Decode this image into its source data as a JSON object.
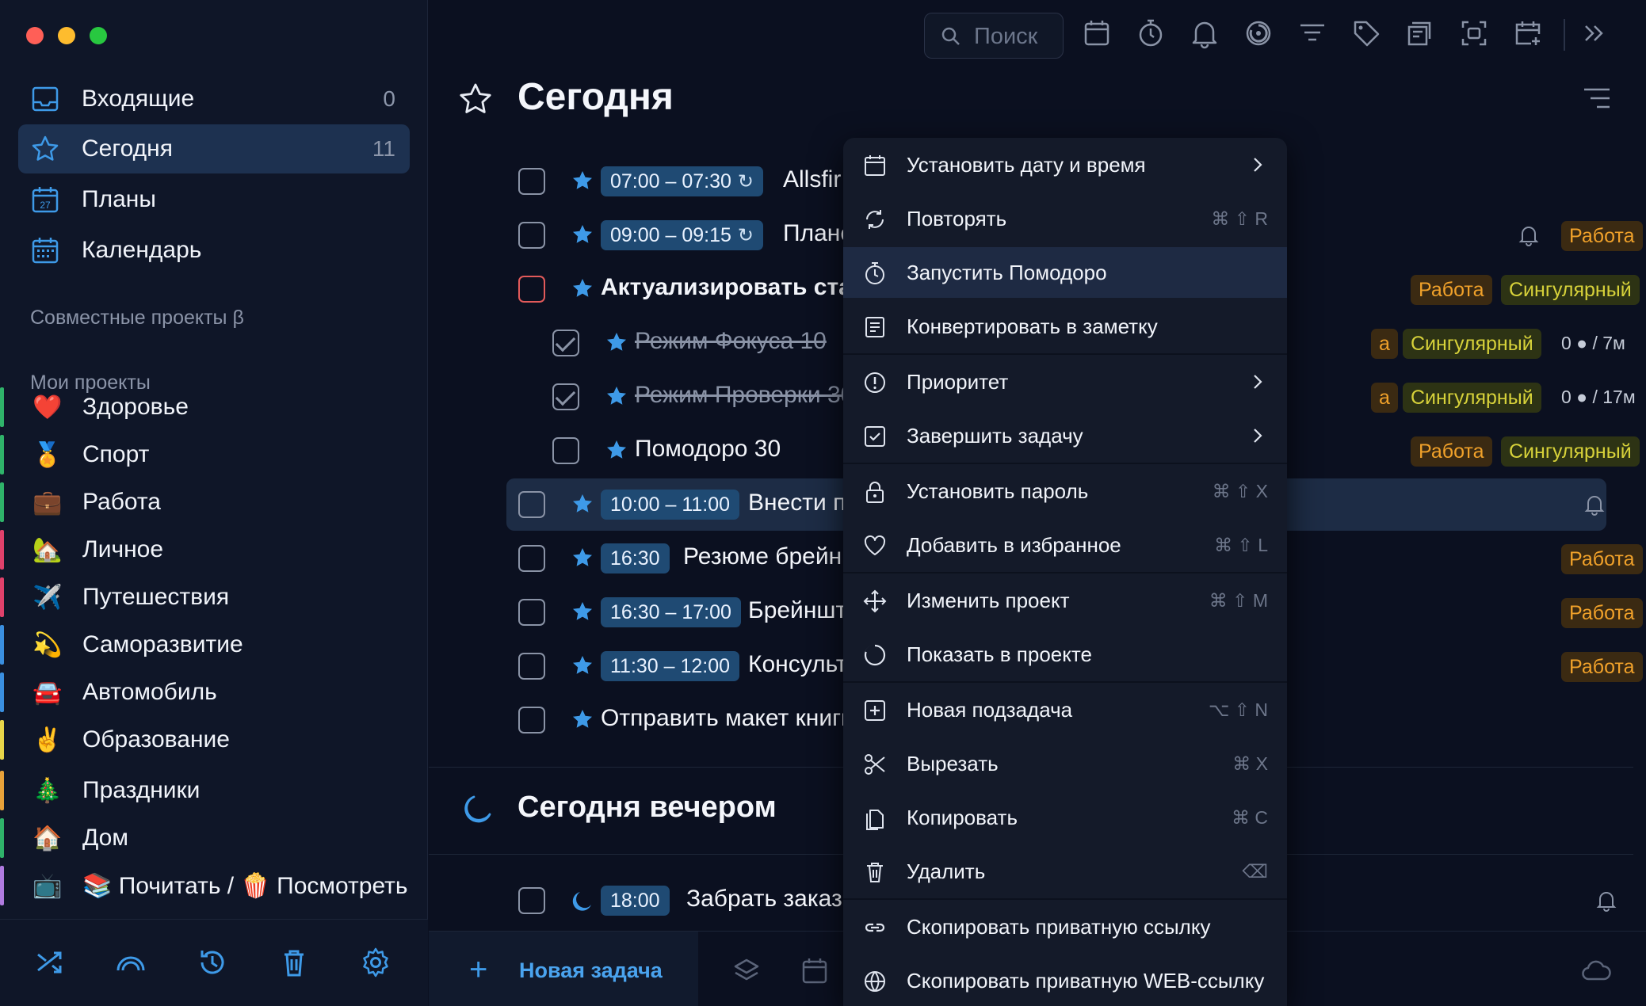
{
  "sidebar": {
    "nav": [
      {
        "label": "Входящие",
        "count": "0",
        "icon": "inbox-icon"
      },
      {
        "label": "Сегодня",
        "count": "11",
        "icon": "star-icon"
      },
      {
        "label": "Планы",
        "count": "",
        "icon": "calendar-27-icon",
        "icon_text": "27"
      },
      {
        "label": "Календарь",
        "count": "",
        "icon": "calendar-grid-icon"
      }
    ],
    "shared_title": "Совместные проекты β",
    "my_title": "Мои проекты",
    "projects": [
      {
        "emoji": "❤️",
        "label": "Здоровье",
        "color": "#2fb36a"
      },
      {
        "emoji": "🏅",
        "label": "Спорт",
        "color": "#2fb36a"
      },
      {
        "emoji": "💼",
        "label": "Работа",
        "color": "#2fb36a"
      },
      {
        "emoji": "🏡",
        "label": "Личное",
        "color": "#e0416b"
      },
      {
        "emoji": "✈️",
        "label": "Путешествия",
        "color": "#e0416b"
      },
      {
        "emoji": "💫",
        "label": "Саморазвитие",
        "color": "#3a8fe0"
      },
      {
        "emoji": "🚘",
        "label": "Автомобиль",
        "color": "#3a8fe0"
      },
      {
        "emoji": "✌️",
        "label": "Образование",
        "color": "#e8d64a"
      },
      {
        "emoji": "🎄",
        "label": "Праздники",
        "color": "#e8a23a"
      },
      {
        "emoji": "🏠",
        "label": "Дом",
        "color": "#2fb36a"
      },
      {
        "emoji": "📺",
        "label": "📚 Почитать / 🍿 Посмотреть",
        "color": "#b07be0"
      }
    ],
    "bottom_icons": [
      "shuffle-icon",
      "rainbow-icon",
      "history-icon",
      "trash-icon",
      "settings-icon"
    ]
  },
  "toolbar": {
    "search_placeholder": "Поиск",
    "icons": [
      "calendar-icon",
      "timer-icon",
      "bell-icon",
      "progress-icon",
      "filter-icon",
      "tag-icon",
      "note-icon",
      "screenshot-icon",
      "add-calendar-icon",
      "expand-icon"
    ]
  },
  "page": {
    "title": "Сегодня",
    "evening_title": "Сегодня вечером"
  },
  "tasks": [
    {
      "time": "07:00 – 07:30",
      "repeat": true,
      "title": "Allsfir",
      "tags": [],
      "meta": "",
      "bell": false
    },
    {
      "time": "09:00 – 09:15",
      "repeat": true,
      "title": "Плане",
      "tags": [
        "Работа"
      ],
      "meta": "",
      "bell": true
    },
    {
      "time": "",
      "title": "Актуализировать стар",
      "bold": true,
      "red": true,
      "tags": [
        "Работа",
        "Сингулярный"
      ],
      "meta": "",
      "bell": false
    },
    {
      "time": "",
      "title": "Режим Фокуса 10",
      "done": true,
      "sub": true,
      "tags": [
        "а",
        "Сингулярный"
      ],
      "meta": "0 ● / 7м",
      "bell": false
    },
    {
      "time": "",
      "title": "Режим Проверки 30",
      "done": true,
      "sub": true,
      "tags": [
        "а",
        "Сингулярный"
      ],
      "meta": "0 ● / 17м",
      "bell": false
    },
    {
      "time": "",
      "title": "Помодоро 30",
      "sub": true,
      "tags": [
        "Работа",
        "Сингулярный"
      ],
      "meta": "",
      "bell": false
    },
    {
      "time": "10:00 – 11:00",
      "title": "Внести п",
      "highlight": true,
      "tags": [],
      "meta": "",
      "bell": true
    },
    {
      "time": "16:30",
      "title": "Резюме брейн",
      "tags": [
        "Работа"
      ],
      "meta": "",
      "bell": false
    },
    {
      "time": "16:30 – 17:00",
      "title": "Брейншт",
      "tags": [
        "Работа"
      ],
      "meta": "",
      "bell": false
    },
    {
      "time": "11:30 – 12:00",
      "title": "Консульт",
      "tags": [
        "Работа"
      ],
      "meta": "",
      "bell": false
    },
    {
      "time": "",
      "title": "Отправить макет книги",
      "tags": [],
      "meta": "",
      "bell": false
    }
  ],
  "evening_tasks": [
    {
      "time": "18:00",
      "title": "Забрать заказ",
      "bell": true
    }
  ],
  "bottom": {
    "new_task_label": "Новая задача",
    "icons": [
      "layers-icon",
      "calendar-icon",
      "cloud-icon"
    ]
  },
  "context_menu": [
    {
      "label": "Установить дату и время",
      "shortcut": "",
      "submenu": true,
      "icon": "calendar-icon"
    },
    {
      "label": "Повторять",
      "shortcut": "⌘ ⇧ R",
      "icon": "repeat-icon"
    },
    {
      "label": "Запустить Помодоро",
      "shortcut": "",
      "highlight": true,
      "icon": "timer-icon"
    },
    {
      "label": "Конвертировать в заметку",
      "shortcut": "",
      "icon": "note-icon"
    },
    {
      "label": "Приоритет",
      "shortcut": "",
      "submenu": true,
      "icon": "priority-icon"
    },
    {
      "label": "Завершить задачу",
      "shortcut": "",
      "submenu": true,
      "icon": "check-square-icon"
    },
    {
      "label": "Установить пароль",
      "shortcut": "⌘ ⇧ X",
      "icon": "lock-icon"
    },
    {
      "label": "Добавить в избранное",
      "shortcut": "⌘ ⇧ L",
      "icon": "heart-icon"
    },
    {
      "label": "Изменить проект",
      "shortcut": "⌘ ⇧ M",
      "icon": "move-icon"
    },
    {
      "label": "Показать в проекте",
      "shortcut": "",
      "icon": "circle-icon"
    },
    {
      "label": "Новая подзадача",
      "shortcut": "⌥ ⇧ N",
      "icon": "plus-square-icon"
    },
    {
      "label": "Вырезать",
      "shortcut": "⌘ X",
      "icon": "scissors-icon"
    },
    {
      "label": "Копировать",
      "shortcut": "⌘ C",
      "icon": "copy-icon"
    },
    {
      "label": "Удалить",
      "shortcut": "⌫",
      "icon": "trash-icon"
    },
    {
      "label": "Скопировать приватную ссылку",
      "shortcut": "",
      "icon": "link-icon"
    },
    {
      "label": "Скопировать приватную WEB-ссылку",
      "shortcut": "",
      "icon": "globe-icon"
    }
  ],
  "colors": {
    "accent": "#3e9ae8",
    "work_tag": "#f0a12a",
    "singular_tag": "#d7d23a"
  }
}
